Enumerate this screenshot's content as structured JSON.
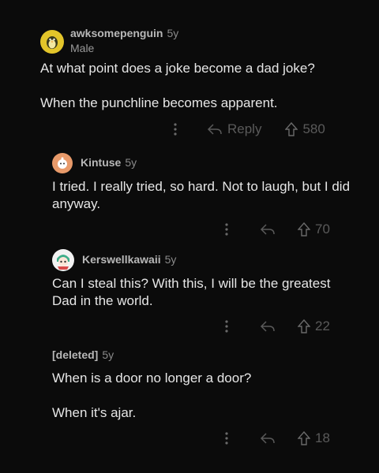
{
  "comments": [
    {
      "author": "awksomepenguin",
      "age": "5y",
      "flair": "Male",
      "body": "At what point does a joke become a dad joke?\n\nWhen the punchline becomes apparent.",
      "reply_label": "Reply",
      "upvotes": "580"
    },
    {
      "author": "Kintuse",
      "age": "5y",
      "body": "I tried. I really tried, so hard. Not to laugh, but I did anyway.",
      "upvotes": "70"
    },
    {
      "author": "Kerswellkawaii",
      "age": "5y",
      "body": "Can I steal this? With this, I will be the greatest Dad in the world.",
      "upvotes": "22"
    },
    {
      "author": "[deleted]",
      "age": "5y",
      "body": "When is a door no longer a door?\n\nWhen it's ajar.",
      "upvotes": "18"
    }
  ],
  "icons": {
    "more": "more-options-icon",
    "reply": "reply-arrow-icon",
    "upvote": "upvote-arrow-icon"
  },
  "colors": {
    "background": "#0b0b0b",
    "text": "#e6e6e6",
    "muted": "#5a5a5a"
  }
}
